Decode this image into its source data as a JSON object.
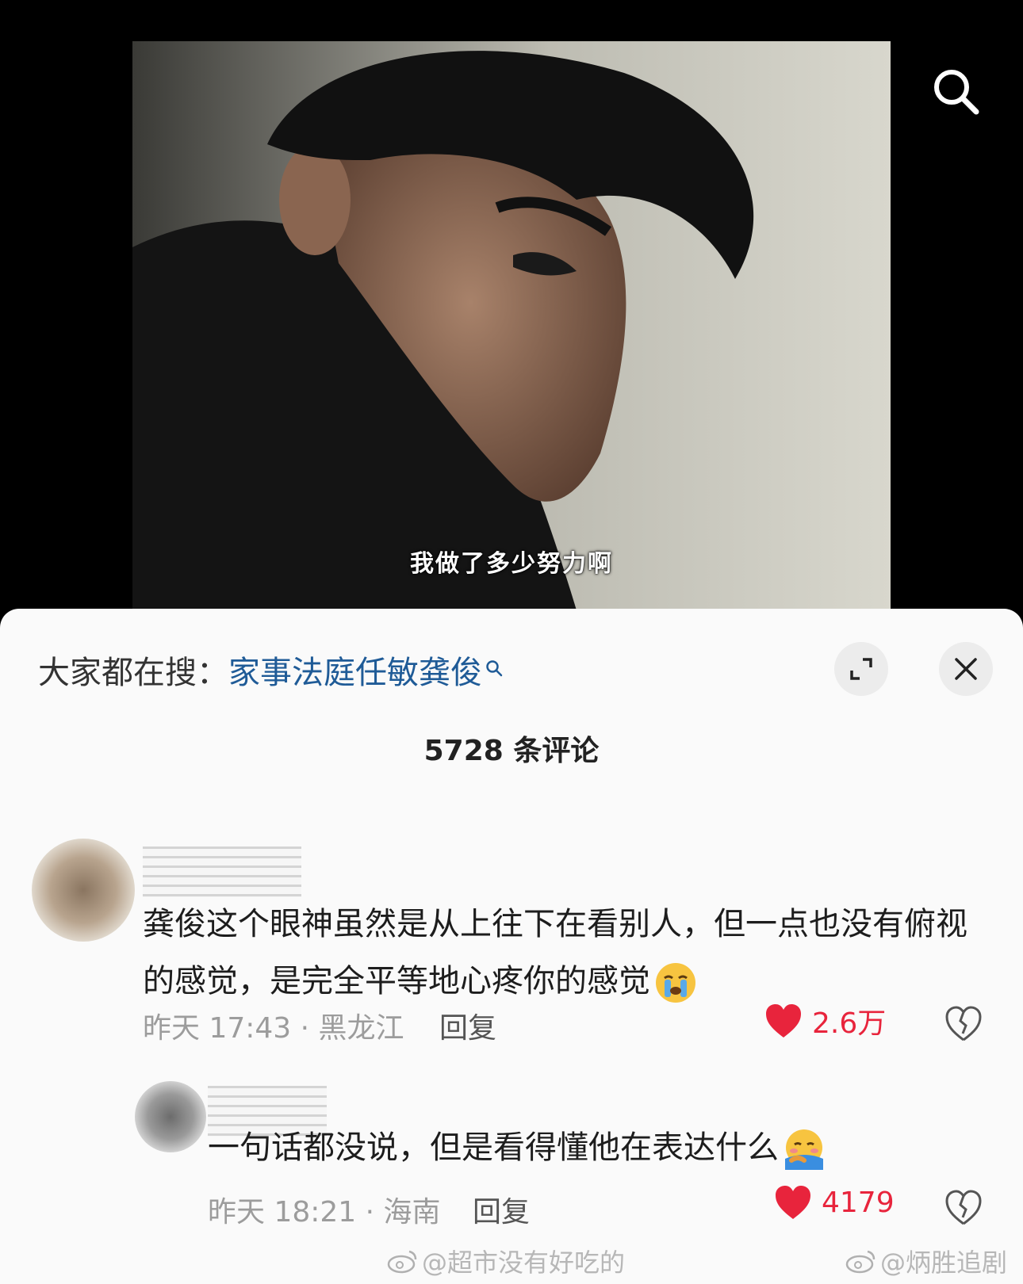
{
  "video": {
    "subtitle": "我做了多少努力啊"
  },
  "search_trending": {
    "prefix": "大家都在搜：",
    "query": "家事法庭任敏龚俊"
  },
  "comments_header": {
    "count_label": "5728 条评论"
  },
  "comments": [
    {
      "text": "龚俊这个眼神虽然是从上往下在看别人，但一点也没有俯视的感觉，是完全平等地心疼你的感觉",
      "emoji": "crying-face",
      "meta": "昨天 17:43 · 黑龙江",
      "reply_label": "回复",
      "likes": "2.6万"
    },
    {
      "text": "一句话都没说，但是看得懂他在表达什么",
      "emoji": "hugging-face",
      "meta": "昨天 18:21 · 海南",
      "reply_label": "回复",
      "likes": "4179"
    }
  ],
  "watermarks": {
    "left": "@超市没有好吃的",
    "right": "@炳胜追剧"
  },
  "colors": {
    "link": "#1f5b97",
    "like": "#e8243c"
  }
}
